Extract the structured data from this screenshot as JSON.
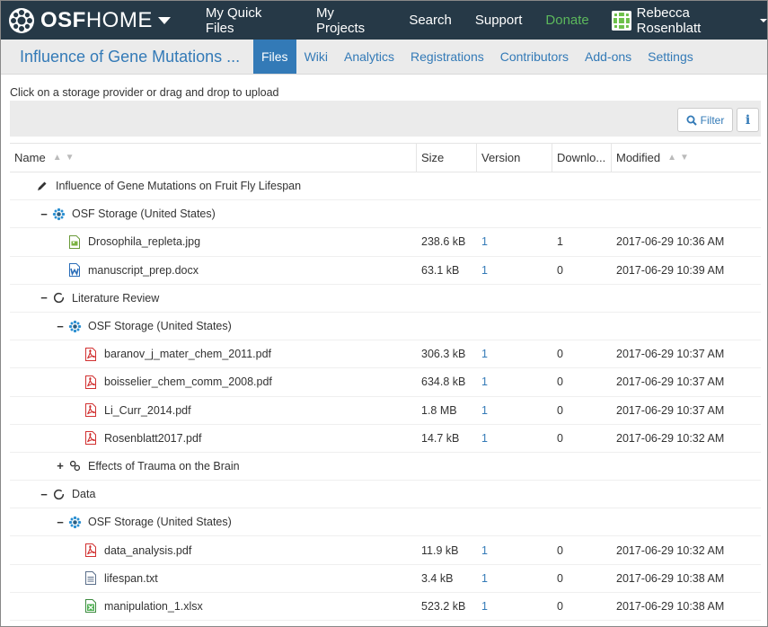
{
  "topnav": {
    "brand": {
      "prefix": "OSF",
      "suffix": "HOME"
    },
    "items": [
      {
        "label": "My Quick Files",
        "name": "nav-my-quick-files"
      },
      {
        "label": "My Projects",
        "name": "nav-my-projects"
      },
      {
        "label": "Search",
        "name": "nav-search"
      },
      {
        "label": "Support",
        "name": "nav-support"
      },
      {
        "label": "Donate",
        "name": "nav-donate"
      }
    ],
    "user": "Rebecca Rosenblatt",
    "colors": {
      "bar": "#263947",
      "donate": "#5cb85c"
    }
  },
  "project": {
    "title": "Influence of Gene Mutations ...",
    "tabs": [
      "Files",
      "Wiki",
      "Analytics",
      "Registrations",
      "Contributors",
      "Add-ons",
      "Settings"
    ],
    "active_tab": "Files"
  },
  "upload_hint": "Click on a storage provider or drag and drop to upload",
  "toolbar": {
    "filter_label": "Filter",
    "info_label": "i"
  },
  "table": {
    "columns": [
      "Name",
      "Size",
      "Version",
      "Downlo...",
      "Modified"
    ],
    "rows": [
      {
        "indent": 0,
        "toggle": "",
        "icon": "pencil-icon",
        "name": "Influence of Gene Mutations on Fruit Fly Lifespan",
        "size": "",
        "version": "",
        "downloads": "",
        "modified": ""
      },
      {
        "indent": 1,
        "toggle": "−",
        "icon": "osf-storage-icon",
        "name": "OSF Storage (United States)",
        "size": "",
        "version": "",
        "downloads": "",
        "modified": ""
      },
      {
        "indent": 2,
        "toggle": "",
        "icon": "image-file-icon",
        "name": "Drosophila_repleta.jpg",
        "size": "238.6 kB",
        "version": "1",
        "downloads": "1",
        "modified": "2017-06-29 10:36 AM"
      },
      {
        "indent": 2,
        "toggle": "",
        "icon": "word-file-icon",
        "name": "manuscript_prep.docx",
        "size": "63.1 kB",
        "version": "1",
        "downloads": "0",
        "modified": "2017-06-29 10:39 AM"
      },
      {
        "indent": 1,
        "toggle": "−",
        "icon": "component-circle-icon",
        "name": "Literature Review",
        "size": "",
        "version": "",
        "downloads": "",
        "modified": ""
      },
      {
        "indent": 2,
        "toggle": "−",
        "icon": "osf-storage-icon",
        "name": "OSF Storage (United States)",
        "size": "",
        "version": "",
        "downloads": "",
        "modified": ""
      },
      {
        "indent": 3,
        "toggle": "",
        "icon": "pdf-file-icon",
        "name": "baranov_j_mater_chem_2011.pdf",
        "size": "306.3 kB",
        "version": "1",
        "downloads": "0",
        "modified": "2017-06-29 10:37 AM"
      },
      {
        "indent": 3,
        "toggle": "",
        "icon": "pdf-file-icon",
        "name": "boisselier_chem_comm_2008.pdf",
        "size": "634.8 kB",
        "version": "1",
        "downloads": "0",
        "modified": "2017-06-29 10:37 AM"
      },
      {
        "indent": 3,
        "toggle": "",
        "icon": "pdf-file-icon",
        "name": "Li_Curr_2014.pdf",
        "size": "1.8 MB",
        "version": "1",
        "downloads": "0",
        "modified": "2017-06-29 10:37 AM"
      },
      {
        "indent": 3,
        "toggle": "",
        "icon": "pdf-file-icon",
        "name": "Rosenblatt2017.pdf",
        "size": "14.7 kB",
        "version": "1",
        "downloads": "0",
        "modified": "2017-06-29 10:32 AM"
      },
      {
        "indent": 2,
        "toggle": "+",
        "icon": "link-icon",
        "name": "Effects of Trauma on the Brain",
        "size": "",
        "version": "",
        "downloads": "",
        "modified": ""
      },
      {
        "indent": 1,
        "toggle": "−",
        "icon": "component-circle-icon",
        "name": "Data",
        "size": "",
        "version": "",
        "downloads": "",
        "modified": ""
      },
      {
        "indent": 2,
        "toggle": "−",
        "icon": "osf-storage-icon",
        "name": "OSF Storage (United States)",
        "size": "",
        "version": "",
        "downloads": "",
        "modified": ""
      },
      {
        "indent": 3,
        "toggle": "",
        "icon": "pdf-file-icon",
        "name": "data_analysis.pdf",
        "size": "11.9 kB",
        "version": "1",
        "downloads": "0",
        "modified": "2017-06-29 10:32 AM"
      },
      {
        "indent": 3,
        "toggle": "",
        "icon": "text-file-icon",
        "name": "lifespan.txt",
        "size": "3.4 kB",
        "version": "1",
        "downloads": "0",
        "modified": "2017-06-29 10:38 AM"
      },
      {
        "indent": 3,
        "toggle": "",
        "icon": "excel-file-icon",
        "name": "manipulation_1.xlsx",
        "size": "523.2 kB",
        "version": "1",
        "downloads": "0",
        "modified": "2017-06-29 10:38 AM"
      }
    ]
  }
}
